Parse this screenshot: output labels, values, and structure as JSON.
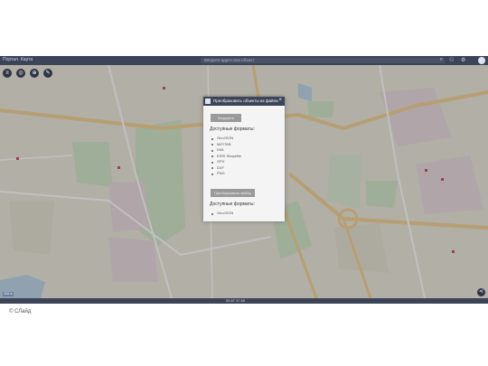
{
  "app": {
    "title": "Портал. Карта",
    "search_placeholder": "Введите адрес или объект",
    "accent": "#3c4458"
  },
  "toolbar": {
    "icons": [
      "layers-icon",
      "target-icon",
      "globe-icon",
      "tools-icon"
    ]
  },
  "dialog": {
    "title": "Преобразовать объекты из файла",
    "upload_button": "Загрузить",
    "available_formats_label": "Доступные форматы:",
    "formats": [
      "GeoJSON",
      "MIF/TAB",
      "KML",
      "ESRI Shapefile",
      "GPX",
      "DXF",
      "PNG"
    ],
    "convert_button": "Преобразовать выбор",
    "output_formats_label": "Доступные форматы:",
    "output_formats": [
      "GeoJSON"
    ]
  },
  "statusbar": {
    "coords": "55.87  37.65",
    "scale": "200 м"
  },
  "footer": {
    "copyright": "© СЛайд"
  }
}
